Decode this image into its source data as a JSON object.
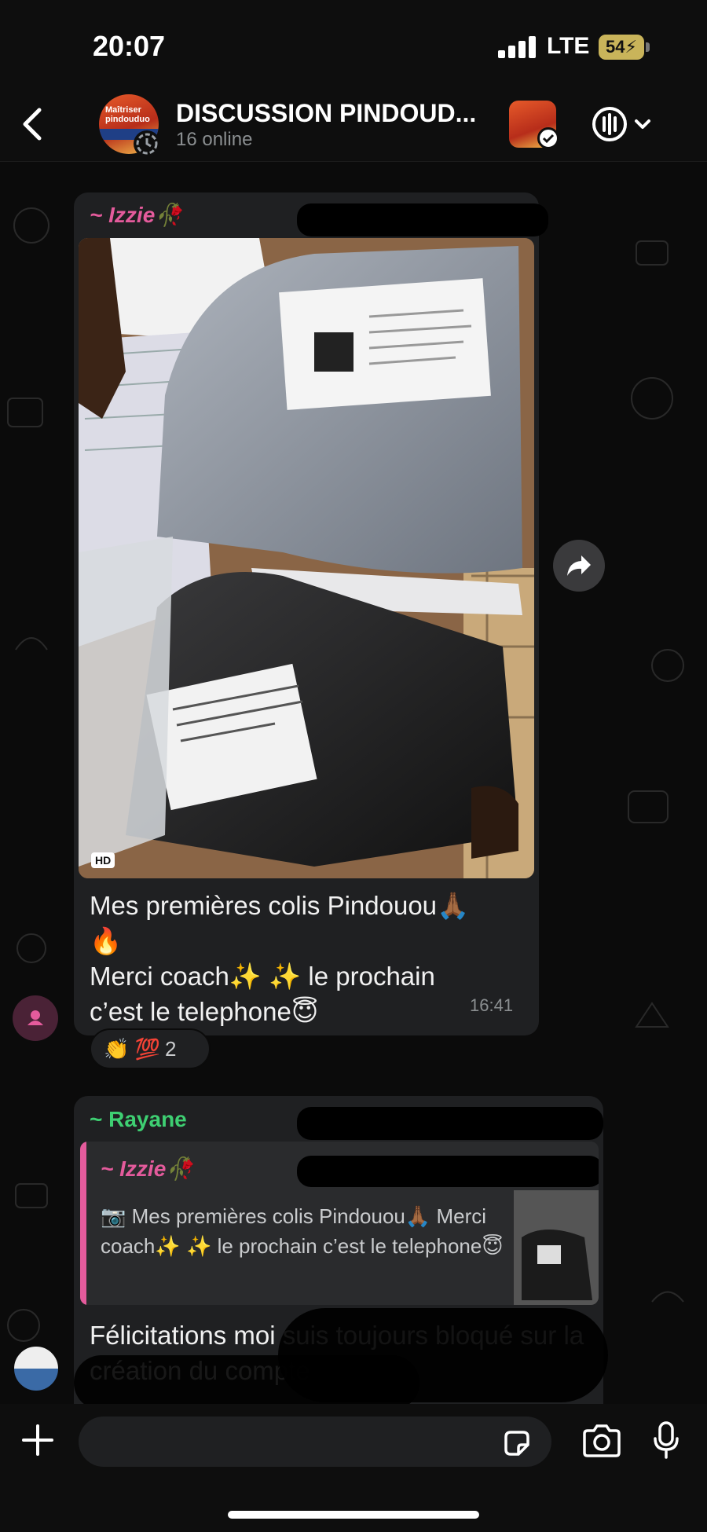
{
  "status_bar": {
    "time": "20:07",
    "network": "LTE",
    "battery": "54"
  },
  "header": {
    "title": "DISCUSSION PINDOUD...",
    "subtitle": "16 online",
    "avatar_text": "Maîtriser pindouduo"
  },
  "messages": [
    {
      "sender": "~ Izzie🥀",
      "has_photo": true,
      "photo_badge": "HD",
      "caption_lines": [
        "Mes premières colis Pindouou🙏🏾",
        "🔥",
        "Merci coach✨ ✨ le prochain",
        "c’est le telephone😇"
      ],
      "time": "16:41",
      "reactions": {
        "emojis": "👏 💯",
        "count": "2"
      }
    },
    {
      "sender": "~ Rayane",
      "quote": {
        "sender": "~ Izzie🥀",
        "text": "📷 Mes premières colis Pindouou🙏🏾 Merci coach✨ ✨ le prochain c’est le telephone😇"
      },
      "text": "Félicitations moi suis toujours bloqué sur la création du compte"
    }
  ],
  "input": {
    "placeholder": ""
  },
  "colors": {
    "izzie": "#e45b9c",
    "rayane": "#3ecf72",
    "bubble": "#1f2022",
    "background": "#0b0b0b"
  },
  "icons": [
    "back-icon",
    "call-icon",
    "chevron-down-icon",
    "forward-icon",
    "plus-icon",
    "sticker-icon",
    "camera-icon",
    "mic-icon",
    "person-icon"
  ]
}
